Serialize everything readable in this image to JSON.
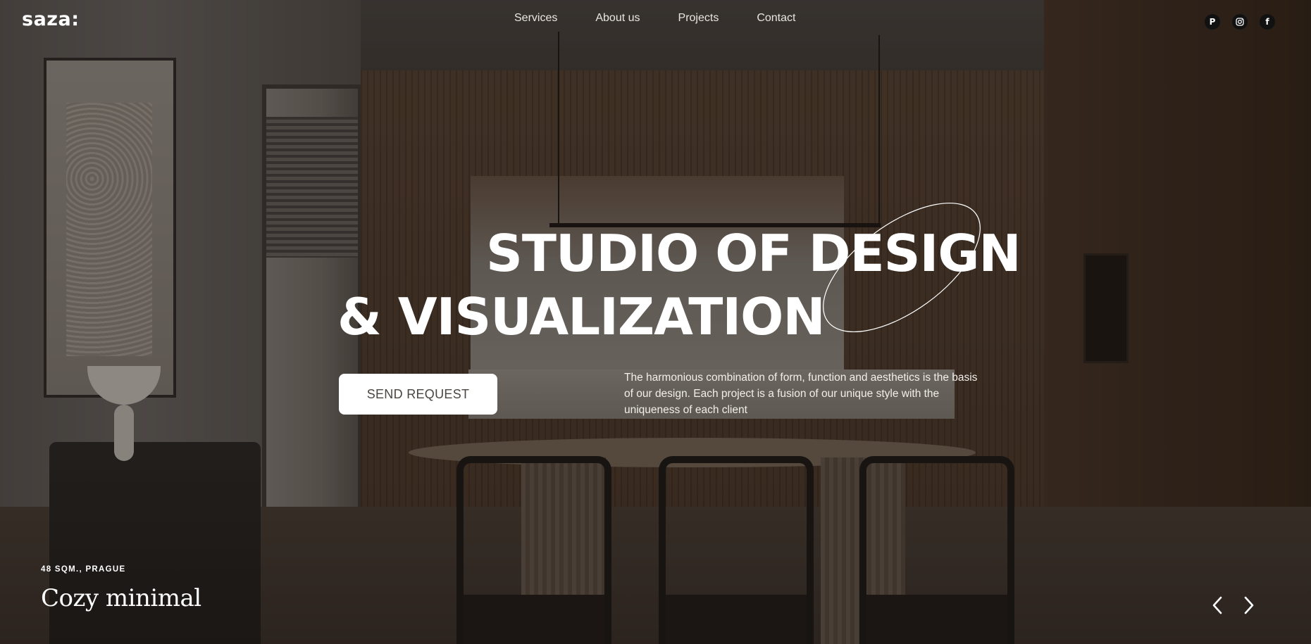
{
  "brand": {
    "logo_text": "saza:"
  },
  "nav": {
    "items": [
      {
        "label": "Services"
      },
      {
        "label": "About us"
      },
      {
        "label": "Projects"
      },
      {
        "label": "Contact"
      }
    ]
  },
  "socials": [
    {
      "icon": "pinterest-icon",
      "glyph": "P"
    },
    {
      "icon": "instagram-icon",
      "glyph": ""
    },
    {
      "icon": "facebook-icon",
      "glyph": "f"
    }
  ],
  "hero": {
    "headline_line1": "STUDIO OF DESIGN",
    "headline_line2": "& VISUALIZATION",
    "cta_label": "SEND REQUEST",
    "description": "The harmonious combination of form, function and aesthetics is the basis of our design. Each project is a fusion of our unique style with the uniqueness of each client"
  },
  "project": {
    "meta": "48 SQM., PRAGUE",
    "title": "Cozy minimal"
  },
  "carousel": {
    "prev_icon": "chevron-left-icon",
    "next_icon": "chevron-right-icon"
  },
  "colors": {
    "text": "#ffffff",
    "button_bg": "#ffffff",
    "button_text": "#4a4540",
    "social_bg": "#111111"
  }
}
